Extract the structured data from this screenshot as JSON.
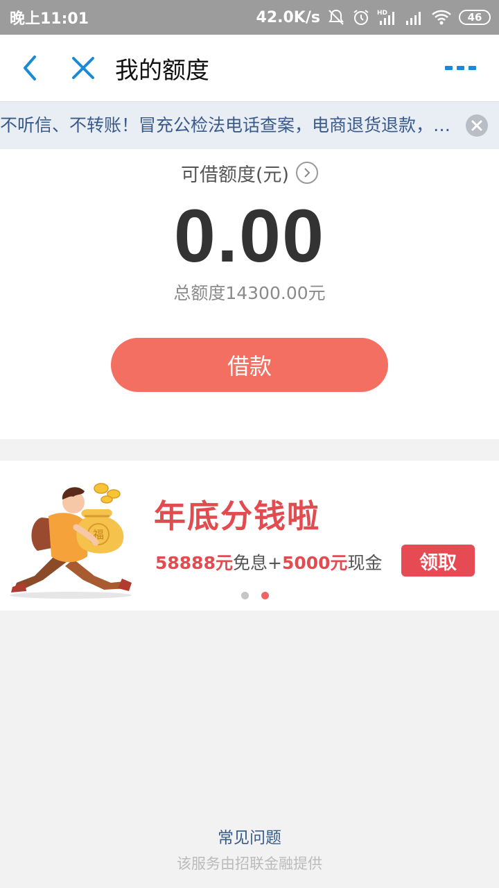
{
  "status_bar": {
    "time": "晚上11:01",
    "network_speed": "42.0K/s",
    "signal_label": "HD",
    "battery": "46",
    "icons": [
      "mute-icon",
      "alarm-icon",
      "signal-hd-icon",
      "signal-icon",
      "wifi-icon",
      "battery-icon"
    ]
  },
  "nav": {
    "title": "我的额度",
    "icons": [
      "back-icon",
      "close-icon",
      "more-icon"
    ],
    "accent_color": "#1a8ad6"
  },
  "notice": {
    "text": "不听信、不转账！冒充公检法电话查案，电商退货退款，…"
  },
  "credit": {
    "label": "可借额度(元)",
    "amount": "0.00",
    "total": "总额度14300.00元",
    "borrow_button": "借款",
    "button_color": "#f36f62"
  },
  "banner": {
    "title": "年底分钱啦",
    "sub_amount1": "58888元",
    "sub_text1": "免息+",
    "sub_amount2": "5000元",
    "sub_text2": "现金",
    "cta": "领取",
    "bag_char": "福",
    "slide_count": 2,
    "active_slide": 2,
    "accent_color": "#e24c50"
  },
  "footer": {
    "faq": "常见问题",
    "provider": "该服务由招联金融提供"
  }
}
